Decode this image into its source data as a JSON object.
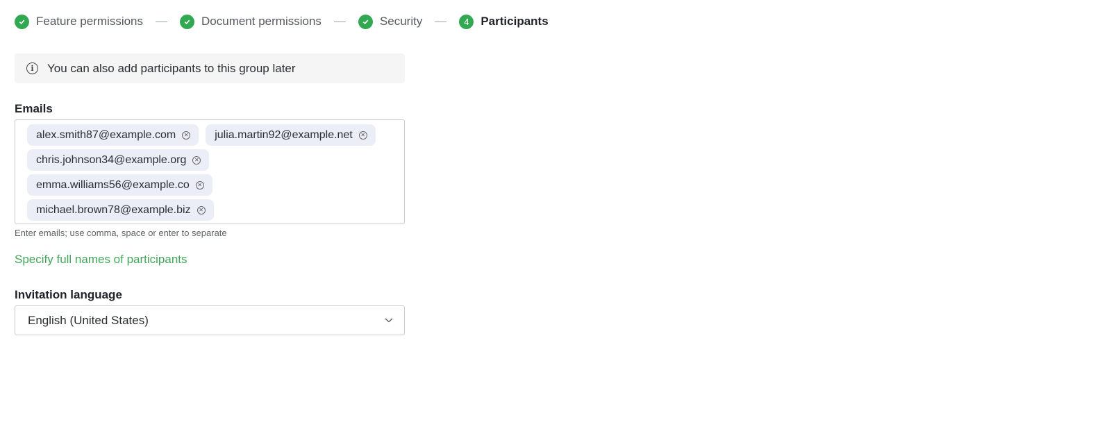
{
  "stepper": {
    "steps": [
      {
        "label": "Feature permissions",
        "status": "done",
        "icon": "check-icon"
      },
      {
        "label": "Document permissions",
        "status": "done",
        "icon": "check-icon"
      },
      {
        "label": "Security",
        "status": "done",
        "icon": "check-icon"
      },
      {
        "label": "Participants",
        "status": "active",
        "number": "4"
      }
    ]
  },
  "info": {
    "icon": "info-icon",
    "text": "You can also add participants to this group later"
  },
  "emails": {
    "label": "Emails",
    "chips": [
      "alex.smith87@example.com",
      "julia.martin92@example.net",
      "chris.johnson34@example.org",
      "emma.williams56@example.co",
      "michael.brown78@example.biz"
    ],
    "hint": "Enter emails; use comma, space or enter to separate"
  },
  "link": "Specify full names of participants",
  "language": {
    "label": "Invitation language",
    "value": "English (United States)"
  },
  "colors": {
    "accent": "#33a852",
    "chip_bg": "#ebedf7",
    "link": "#43a55a"
  }
}
